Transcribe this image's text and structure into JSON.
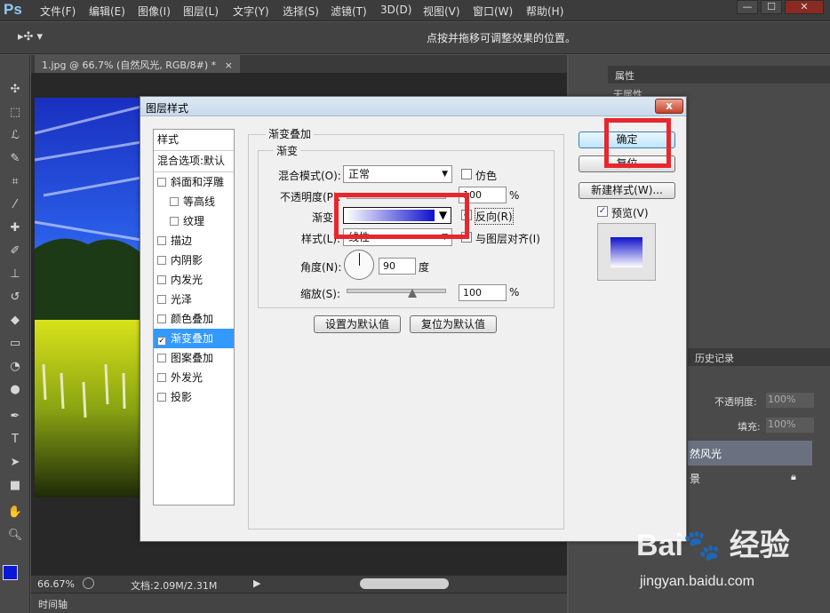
{
  "app": {
    "logo": "Ps",
    "menu": [
      "文件(F)",
      "编辑(E)",
      "图像(I)",
      "图层(L)",
      "文字(Y)",
      "选择(S)",
      "滤镜(T)",
      "3D(D)",
      "视图(V)",
      "窗口(W)",
      "帮助(H)"
    ],
    "window_controls": [
      "—",
      "☐",
      "✕"
    ]
  },
  "options_bar": {
    "hint": "点按并拖移可调整效果的位置。"
  },
  "document": {
    "tab_label": "1.jpg @ 66.7% (自然风光, RGB/8#) *",
    "tab_close": "×",
    "zoom": "66.67%",
    "doc_size": "文档:2.09M/2.31M",
    "timeline_label": "时间轴"
  },
  "right_panels": {
    "properties_tab": "属性",
    "properties_sub": "无属性",
    "history_tab": "历史记录",
    "opacity_label": "不透明度:",
    "opacity_value": "100%",
    "fill_label": "填充:",
    "fill_value": "100%",
    "layer_name": "然风光",
    "background_layer": "景"
  },
  "dialog": {
    "title": "图层样式",
    "close": "x",
    "styles_header": "样式",
    "blend_options": "混合选项:默认",
    "style_items": [
      {
        "label": "斜面和浮雕",
        "checked": false,
        "indent": false
      },
      {
        "label": "等高线",
        "checked": false,
        "indent": true
      },
      {
        "label": "纹理",
        "checked": false,
        "indent": true
      },
      {
        "label": "描边",
        "checked": false,
        "indent": false
      },
      {
        "label": "内阴影",
        "checked": false,
        "indent": false
      },
      {
        "label": "内发光",
        "checked": false,
        "indent": false
      },
      {
        "label": "光泽",
        "checked": false,
        "indent": false
      },
      {
        "label": "颜色叠加",
        "checked": false,
        "indent": false
      },
      {
        "label": "渐变叠加",
        "checked": true,
        "indent": false
      },
      {
        "label": "图案叠加",
        "checked": false,
        "indent": false
      },
      {
        "label": "外发光",
        "checked": false,
        "indent": false
      },
      {
        "label": "投影",
        "checked": false,
        "indent": false
      }
    ],
    "section_title": "渐变叠加",
    "subsection_title": "渐变",
    "blend_mode_label": "混合模式(O):",
    "blend_mode_value": "正常",
    "dither_label": "仿色",
    "opacity_label": "不透明度(P):",
    "opacity_value": "100",
    "percent": "%",
    "gradient_label": "渐变:",
    "reverse_label": "反向(R)",
    "reverse_checked": true,
    "style_label": "样式(L):",
    "style_value": "线性",
    "align_label": "与图层对齐(I)",
    "align_checked": true,
    "angle_label": "角度(N):",
    "angle_value": "90",
    "degree": "度",
    "scale_label": "缩放(S):",
    "scale_value": "100",
    "scale_percent": 100,
    "set_default": "设置为默认值",
    "reset_default": "复位为默认值",
    "ok": "确定",
    "cancel": "复位",
    "new_style": "新建样式(W)...",
    "preview_label": "预览(V)",
    "preview_checked": true,
    "gradient_colors": [
      "#ffffff",
      "#1111cc"
    ]
  }
}
